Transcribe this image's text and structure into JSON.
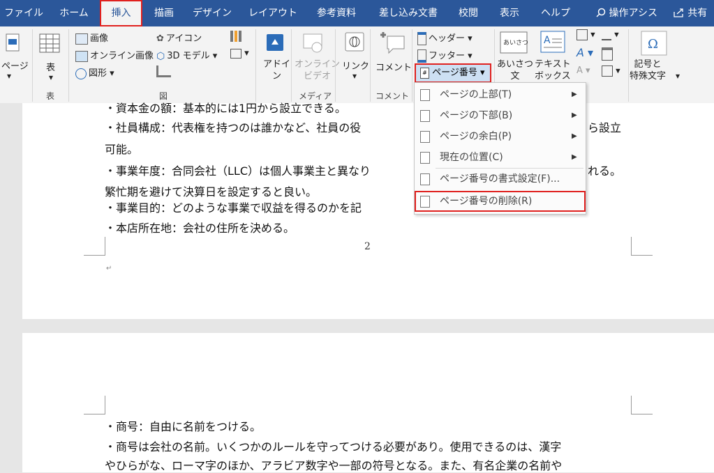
{
  "tabs": [
    "ファイル",
    "ホーム",
    "挿入",
    "描画",
    "デザイン",
    "レイアウト",
    "参考資料",
    "差し込み文書",
    "校閲",
    "表示",
    "ヘルプ"
  ],
  "search_label": "操作アシス",
  "share_label": "共有",
  "ribbon": {
    "page_label": "ページ",
    "table_label": "表",
    "table_group": "表",
    "image": "画像",
    "online_image": "オンライン画像",
    "shapes": "図形",
    "icons": "アイコン",
    "models3d": "3D モデル",
    "figure_group": "図",
    "addin": "アドイ\nン",
    "online_video": "オンライン\nビデオ",
    "media_group": "メディア",
    "link": "リンク",
    "comment": "コメント",
    "comment_group": "コメント",
    "header": "ヘッダー",
    "footer": "フッター",
    "page_number": "ページ番号",
    "greeting": "あいさつ\n文",
    "textbox": "テキスト\nボックス",
    "symbols": "記号と\n特殊文字"
  },
  "menu": {
    "items": [
      {
        "label": "ページの上部(T)",
        "arrow": "▶"
      },
      {
        "label": "ページの下部(B)",
        "arrow": "▶"
      },
      {
        "label": "ページの余白(P)",
        "arrow": "▶"
      },
      {
        "label": "現在の位置(C)",
        "arrow": "▶"
      },
      {
        "label": "ページ番号の書式設定(F)...",
        "arrow": ""
      },
      {
        "label": "ページ番号の削除(R)",
        "arrow": ""
      }
    ]
  },
  "doc": {
    "page1_lines": [
      "・資本金の額：基本的には1円から設立できる。",
      "・社員構成：代表権を持つのは誰かなど、社員の役",
      "可能。",
      "・事業年度：合同会社（LLC）は個人事業主と異なり",
      "繁忙期を避けて決算日を設定すると良い。",
      "・事業目的：どのような事業で収益を得るのかを記",
      "・本店所在地：会社の住所を決める。"
    ],
    "page1_tails": [
      "ら設立",
      "れる。"
    ],
    "page_number": "2",
    "page2_lines": [
      "・商号：自由に名前をつける。",
      "・商号は会社の名前。いくつかのルールを守ってつける必要があり。使用できるのは、漢字",
      "やひらがな、ローマ字のほか、アラビア数字や一部の符号となる。また、有名企業の名前や"
    ]
  },
  "colors": {
    "title_bar": "#2b579a",
    "highlight": "#e0201e"
  }
}
